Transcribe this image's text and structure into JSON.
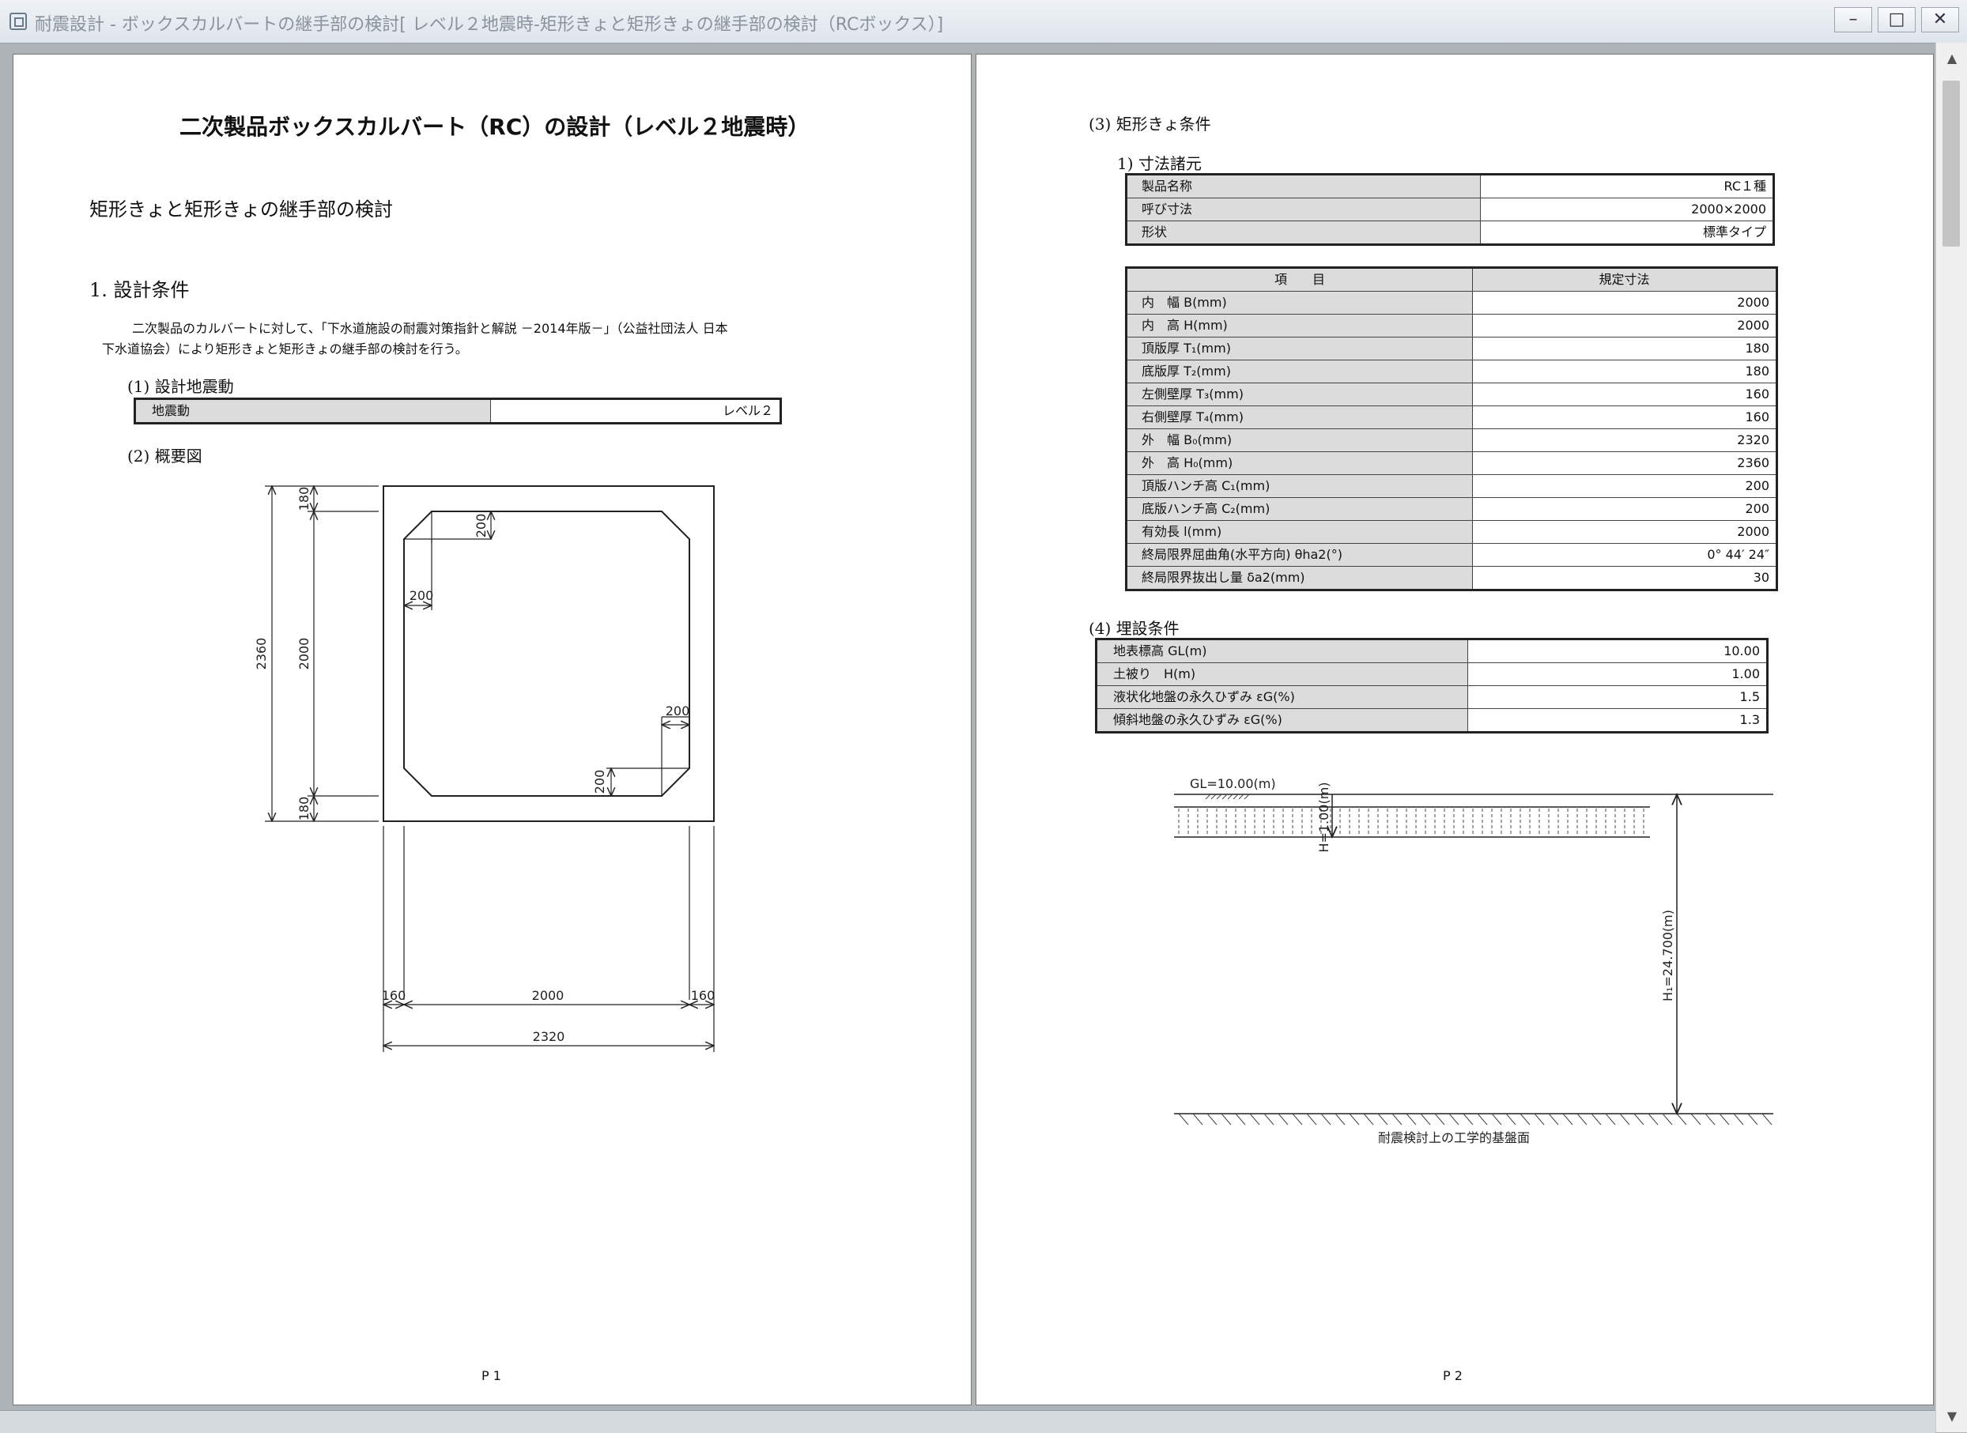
{
  "window": {
    "title": "耐震設計 - ボックスカルバートの継手部の検討[ レベル２地震時-矩形きょと矩形きょの継手部の検討（RCボックス）]",
    "minimize": "–",
    "maximize": "□",
    "close": "✕"
  },
  "page1": {
    "title": "二次製品ボックスカルバート（RC）の設計（レベル２地震時）",
    "subtitle": "矩形きょと矩形きょの継手部の検討",
    "section1": "1.  設計条件",
    "intro_line1": "二次製品のカルバートに対して、「下水道施設の耐震対策指針と解説 －2014年版－」（公益社団法人 日本",
    "intro_line2": "下水道協会）により矩形きょと矩形きょの継手部の検討を行う。",
    "sub1": "(1)  設計地震動",
    "quake": {
      "label": "地震動",
      "value": "レベル２"
    },
    "sub2": "(2)  概要図",
    "figure": {
      "dims": {
        "top_slab": "180",
        "inner_height": "2000",
        "bottom_slab": "180",
        "outer_height": "2360",
        "haunch_tr_v": "200",
        "haunch_tl_h": "200",
        "haunch_br_h": "200",
        "haunch_bl_v": "200",
        "left_wall": "160",
        "inner_width": "2000",
        "right_wall": "160",
        "outer_width": "2320"
      }
    },
    "page_num": "P 1"
  },
  "page2": {
    "sub3": "(3)  矩形きょ条件",
    "sub3_1": "1)  寸法諸元",
    "product": [
      {
        "label": "製品名称",
        "value": "RC１種"
      },
      {
        "label": "呼び寸法",
        "value": "2000×2000"
      },
      {
        "label": "形状",
        "value": "標準タイプ"
      }
    ],
    "dims_header": {
      "item": "項　　目",
      "value": "規定寸法"
    },
    "dims": [
      {
        "label": "内　幅 B(mm)",
        "value": "2000"
      },
      {
        "label": "内　高 H(mm)",
        "value": "2000"
      },
      {
        "label": "頂版厚 T₁(mm)",
        "value": "180"
      },
      {
        "label": "底版厚 T₂(mm)",
        "value": "180"
      },
      {
        "label": "左側壁厚 T₃(mm)",
        "value": "160"
      },
      {
        "label": "右側壁厚 T₄(mm)",
        "value": "160"
      },
      {
        "label": "外　幅 B₀(mm)",
        "value": "2320"
      },
      {
        "label": "外　高 H₀(mm)",
        "value": "2360"
      },
      {
        "label": "頂版ハンチ高 C₁(mm)",
        "value": "200"
      },
      {
        "label": "底版ハンチ高 C₂(mm)",
        "value": "200"
      },
      {
        "label": "有効長 l(mm)",
        "value": "2000"
      },
      {
        "label": "終局限界屈曲角(水平方向) θha2(°)",
        "value": "0° 44′ 24″"
      },
      {
        "label": "終局限界抜出し量 δa2(mm)",
        "value": "30"
      }
    ],
    "sub4": "(4)  埋設条件",
    "burial": [
      {
        "label": "地表標高 GL(m)",
        "value": "10.00"
      },
      {
        "label": "土被り　H(m)",
        "value": "1.00"
      },
      {
        "label": "液状化地盤の永久ひずみ εG(%)",
        "value": "1.5"
      },
      {
        "label": "傾斜地盤の永久ひずみ εG(%)",
        "value": "1.3"
      }
    ],
    "ground": {
      "gl_label": "GL=10.00(m)",
      "cover_label": "H=1.00(m)",
      "depth_label": "H₁=24.700(m)",
      "base_label": "耐震検討上の工学的基盤面"
    },
    "page_num": "P 2"
  }
}
